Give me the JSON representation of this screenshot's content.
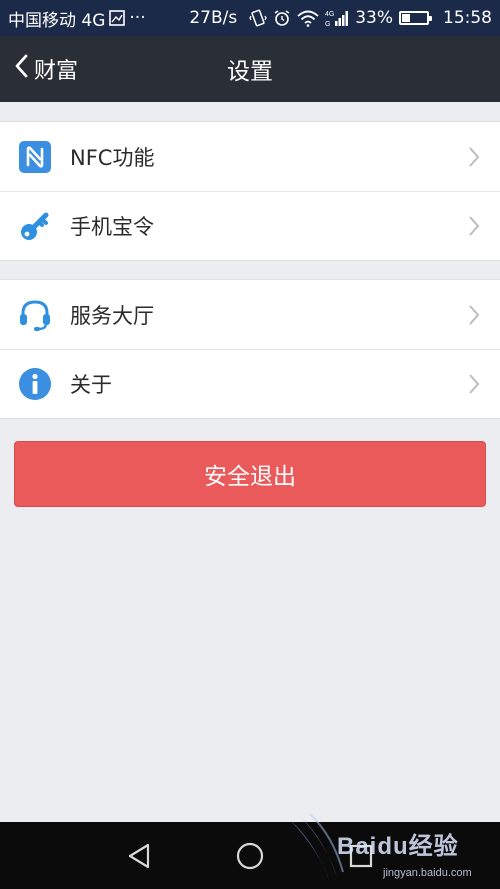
{
  "status_bar": {
    "carrier": "中国移动 4G",
    "more": "···",
    "net_speed": "27B/s",
    "battery_text": "33%",
    "battery_level": 0.33,
    "time": "15:58",
    "icons": [
      "image-icon",
      "vibrate-icon",
      "alarm-icon",
      "wifi-icon",
      "signal-4g-icon",
      "battery-icon"
    ]
  },
  "header": {
    "back_label": "财富",
    "title": "设置"
  },
  "settings": {
    "group1": [
      {
        "label": "NFC功能",
        "icon": "nfc-icon"
      },
      {
        "label": "手机宝令",
        "icon": "key-icon"
      }
    ],
    "group2": [
      {
        "label": "服务大厅",
        "icon": "headset-icon"
      },
      {
        "label": "关于",
        "icon": "info-icon"
      }
    ]
  },
  "logout": {
    "label": "安全退出"
  },
  "nav_bar": {
    "icons": [
      "back-triangle-icon",
      "home-circle-icon",
      "recent-square-icon"
    ]
  },
  "watermark": {
    "text": "Baidu经验",
    "url": "jingyan.baidu.com"
  },
  "colors": {
    "status_bar": "#1c2a4a",
    "title_bar": "#2a2e36",
    "background": "#ecedf1",
    "icon_blue": "#2f8fe0",
    "logout_red": "#ea5a5a"
  }
}
